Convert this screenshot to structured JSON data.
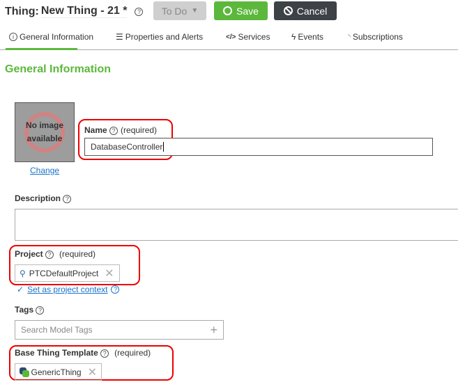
{
  "header": {
    "entity_type": "Thing:",
    "entity_name": "New Thing - 21 *",
    "state_label": "To Do",
    "save_label": "Save",
    "cancel_label": "Cancel"
  },
  "tabs": [
    {
      "label": "General Information",
      "icon": "info-icon"
    },
    {
      "label": "Properties and Alerts",
      "icon": "list-icon"
    },
    {
      "label": "Services",
      "icon": "code-icon"
    },
    {
      "label": "Events",
      "icon": "lightning-icon"
    },
    {
      "label": "Subscriptions",
      "icon": "rss-icon"
    }
  ],
  "section_title": "General Information",
  "image": {
    "placeholder": "No image available",
    "change_label": "Change"
  },
  "name": {
    "label": "Name",
    "required": "(required)",
    "value": "DatabaseController"
  },
  "description": {
    "label": "Description",
    "value": ""
  },
  "project": {
    "label": "Project",
    "required": "(required)",
    "value": "PTCDefaultProject",
    "context_link": "Set as project context"
  },
  "tags": {
    "label": "Tags",
    "placeholder": "Search Model Tags"
  },
  "base_template": {
    "label": "Base Thing Template",
    "required": "(required)",
    "value": "GenericThing"
  },
  "colors": {
    "accent": "#5cb83c",
    "cancel": "#3c4245",
    "highlight": "#e00000",
    "link": "#1a73c9"
  }
}
